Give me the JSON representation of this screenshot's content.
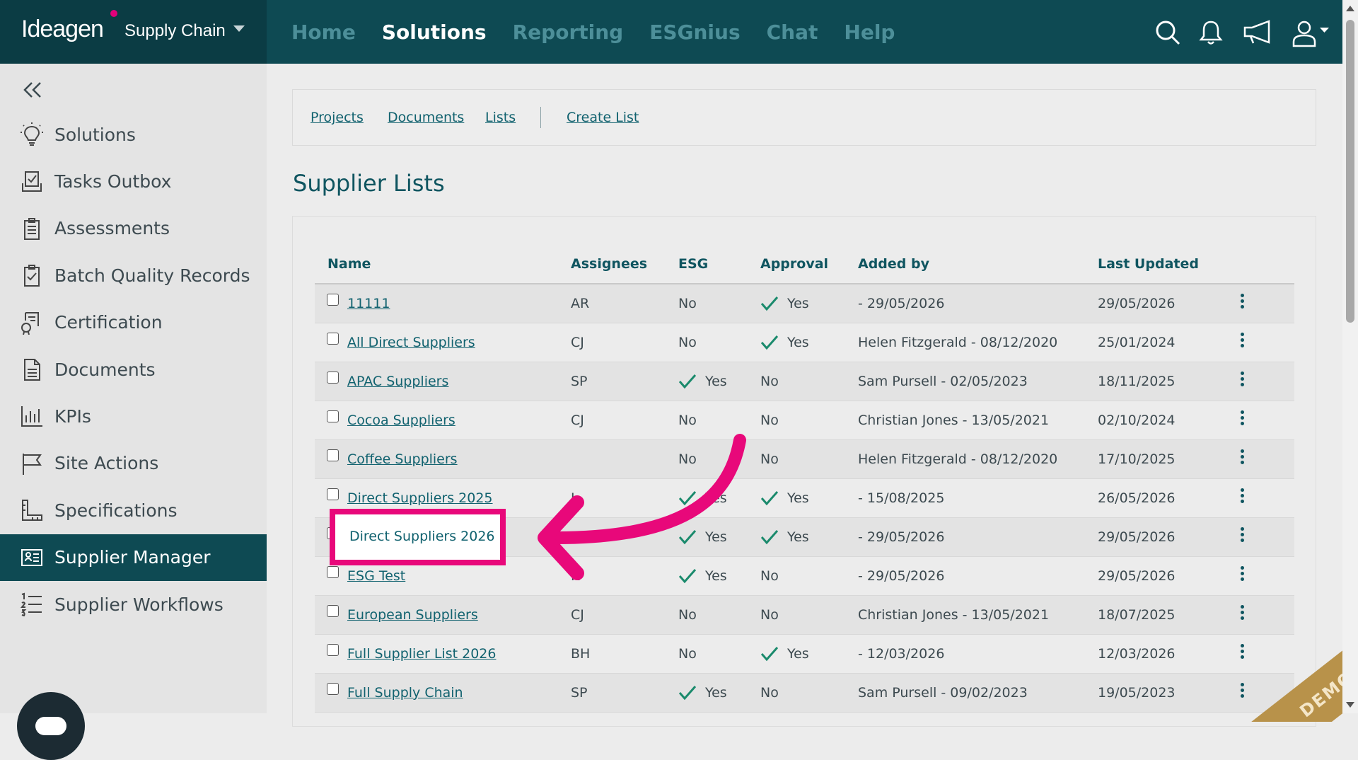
{
  "brand": {
    "logo": "Ideagen",
    "product": "Supply Chain"
  },
  "nav": {
    "items": [
      {
        "label": "Home",
        "active": false
      },
      {
        "label": "Solutions",
        "active": true
      },
      {
        "label": "Reporting",
        "active": false
      },
      {
        "label": "ESGnius",
        "active": false
      },
      {
        "label": "Chat",
        "active": false
      },
      {
        "label": "Help",
        "active": false
      }
    ]
  },
  "sidebar": {
    "items": [
      {
        "label": "Solutions",
        "icon": "lightbulb-icon"
      },
      {
        "label": "Tasks Outbox",
        "icon": "tray-check-icon"
      },
      {
        "label": "Assessments",
        "icon": "clipboard-icon"
      },
      {
        "label": "Batch Quality Records",
        "icon": "clipboard-check-icon"
      },
      {
        "label": "Certification",
        "icon": "certificate-icon"
      },
      {
        "label": "Documents",
        "icon": "document-icon"
      },
      {
        "label": "KPIs",
        "icon": "bar-chart-icon"
      },
      {
        "label": "Site Actions",
        "icon": "flag-icon"
      },
      {
        "label": "Specifications",
        "icon": "ruler-icon"
      },
      {
        "label": "Supplier Manager",
        "icon": "id-card-icon",
        "active": true
      },
      {
        "label": "Supplier Workflows",
        "icon": "numbered-list-icon"
      }
    ]
  },
  "subnav": {
    "projects": "Projects",
    "documents": "Documents",
    "lists": "Lists",
    "create_list": "Create List"
  },
  "page": {
    "title": "Supplier Lists"
  },
  "table": {
    "headers": {
      "name": "Name",
      "assignees": "Assignees",
      "esg": "ESG",
      "approval": "Approval",
      "added_by": "Added by",
      "last_updated": "Last Updated"
    },
    "rows": [
      {
        "name": "11111",
        "assignees": "AR",
        "esg": "No",
        "approval": "Yes",
        "added_by": "- 29/05/2026",
        "last_updated": "29/05/2026"
      },
      {
        "name": "All Direct Suppliers",
        "assignees": "CJ",
        "esg": "No",
        "approval": "Yes",
        "added_by": "Helen Fitzgerald - 08/12/2020",
        "last_updated": "25/01/2024"
      },
      {
        "name": "APAC Suppliers",
        "assignees": "SP",
        "esg": "Yes",
        "approval": "No",
        "added_by": "Sam Pursell - 02/05/2023",
        "last_updated": "18/11/2025"
      },
      {
        "name": "Cocoa Suppliers",
        "assignees": "CJ",
        "esg": "No",
        "approval": "No",
        "added_by": "Christian Jones - 13/05/2021",
        "last_updated": "02/10/2024"
      },
      {
        "name": "Coffee Suppliers",
        "assignees": "",
        "esg": "No",
        "approval": "No",
        "added_by": "Helen Fitzgerald - 08/12/2020",
        "last_updated": "17/10/2025"
      },
      {
        "name": "Direct Suppliers 2025",
        "assignees": "L",
        "esg": "Yes",
        "approval": "Yes",
        "added_by": "- 15/08/2025",
        "last_updated": "26/05/2026"
      },
      {
        "name": "Direct Suppliers 2026",
        "assignees": "",
        "esg": "Yes",
        "approval": "Yes",
        "added_by": "- 29/05/2026",
        "last_updated": "29/05/2026"
      },
      {
        "name": "ESG Test",
        "assignees": "R",
        "esg": "Yes",
        "approval": "No",
        "added_by": "- 29/05/2026",
        "last_updated": "29/05/2026"
      },
      {
        "name": "European Suppliers",
        "assignees": "CJ",
        "esg": "No",
        "approval": "No",
        "added_by": "Christian Jones - 13/05/2021",
        "last_updated": "18/07/2025"
      },
      {
        "name": "Full Supplier List 2026",
        "assignees": "BH",
        "esg": "No",
        "approval": "Yes",
        "added_by": "- 12/03/2026",
        "last_updated": "12/03/2026"
      },
      {
        "name": "Full Supply Chain",
        "assignees": "SP",
        "esg": "Yes",
        "approval": "No",
        "added_by": "Sam Pursell - 09/02/2023",
        "last_updated": "19/05/2023"
      }
    ]
  },
  "highlight": {
    "label": "Direct Suppliers 2026"
  },
  "watermark": "DEMO",
  "colors": {
    "header_bg": "#0e4a53",
    "accent_link": "#11626f",
    "check_green": "#1a8a6c",
    "highlight_pink": "#e8087a"
  }
}
